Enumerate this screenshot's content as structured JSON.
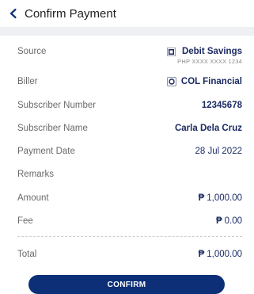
{
  "header": {
    "title": "Confirm Payment",
    "back_icon": "chevron-left-icon"
  },
  "details": {
    "source": {
      "label": "Source",
      "value": "Debit Savings",
      "account": "PHP XXXX XXXX 1234",
      "icon": "bank-card-icon"
    },
    "biller": {
      "label": "Biller",
      "value": "COL Financial",
      "icon": "biller-logo-icon"
    },
    "subscriber_number": {
      "label": "Subscriber Number",
      "value": "12345678"
    },
    "subscriber_name": {
      "label": "Subscriber Name",
      "value": "Carla Dela Cruz"
    },
    "payment_date": {
      "label": "Payment Date",
      "value": "28 Jul 2022"
    },
    "remarks": {
      "label": "Remarks",
      "value": ""
    },
    "amount": {
      "label": "Amount",
      "currency": "₱",
      "value": "1,000.00"
    },
    "fee": {
      "label": "Fee",
      "currency": "₱",
      "value": "0.00"
    },
    "total": {
      "label": "Total",
      "currency": "₱",
      "value": "1,000.00"
    }
  },
  "actions": {
    "confirm_label": "CONFIRM"
  },
  "colors": {
    "primary": "#0c2f78",
    "value_text": "#1b2a63",
    "background_band": "#eef0f3"
  }
}
